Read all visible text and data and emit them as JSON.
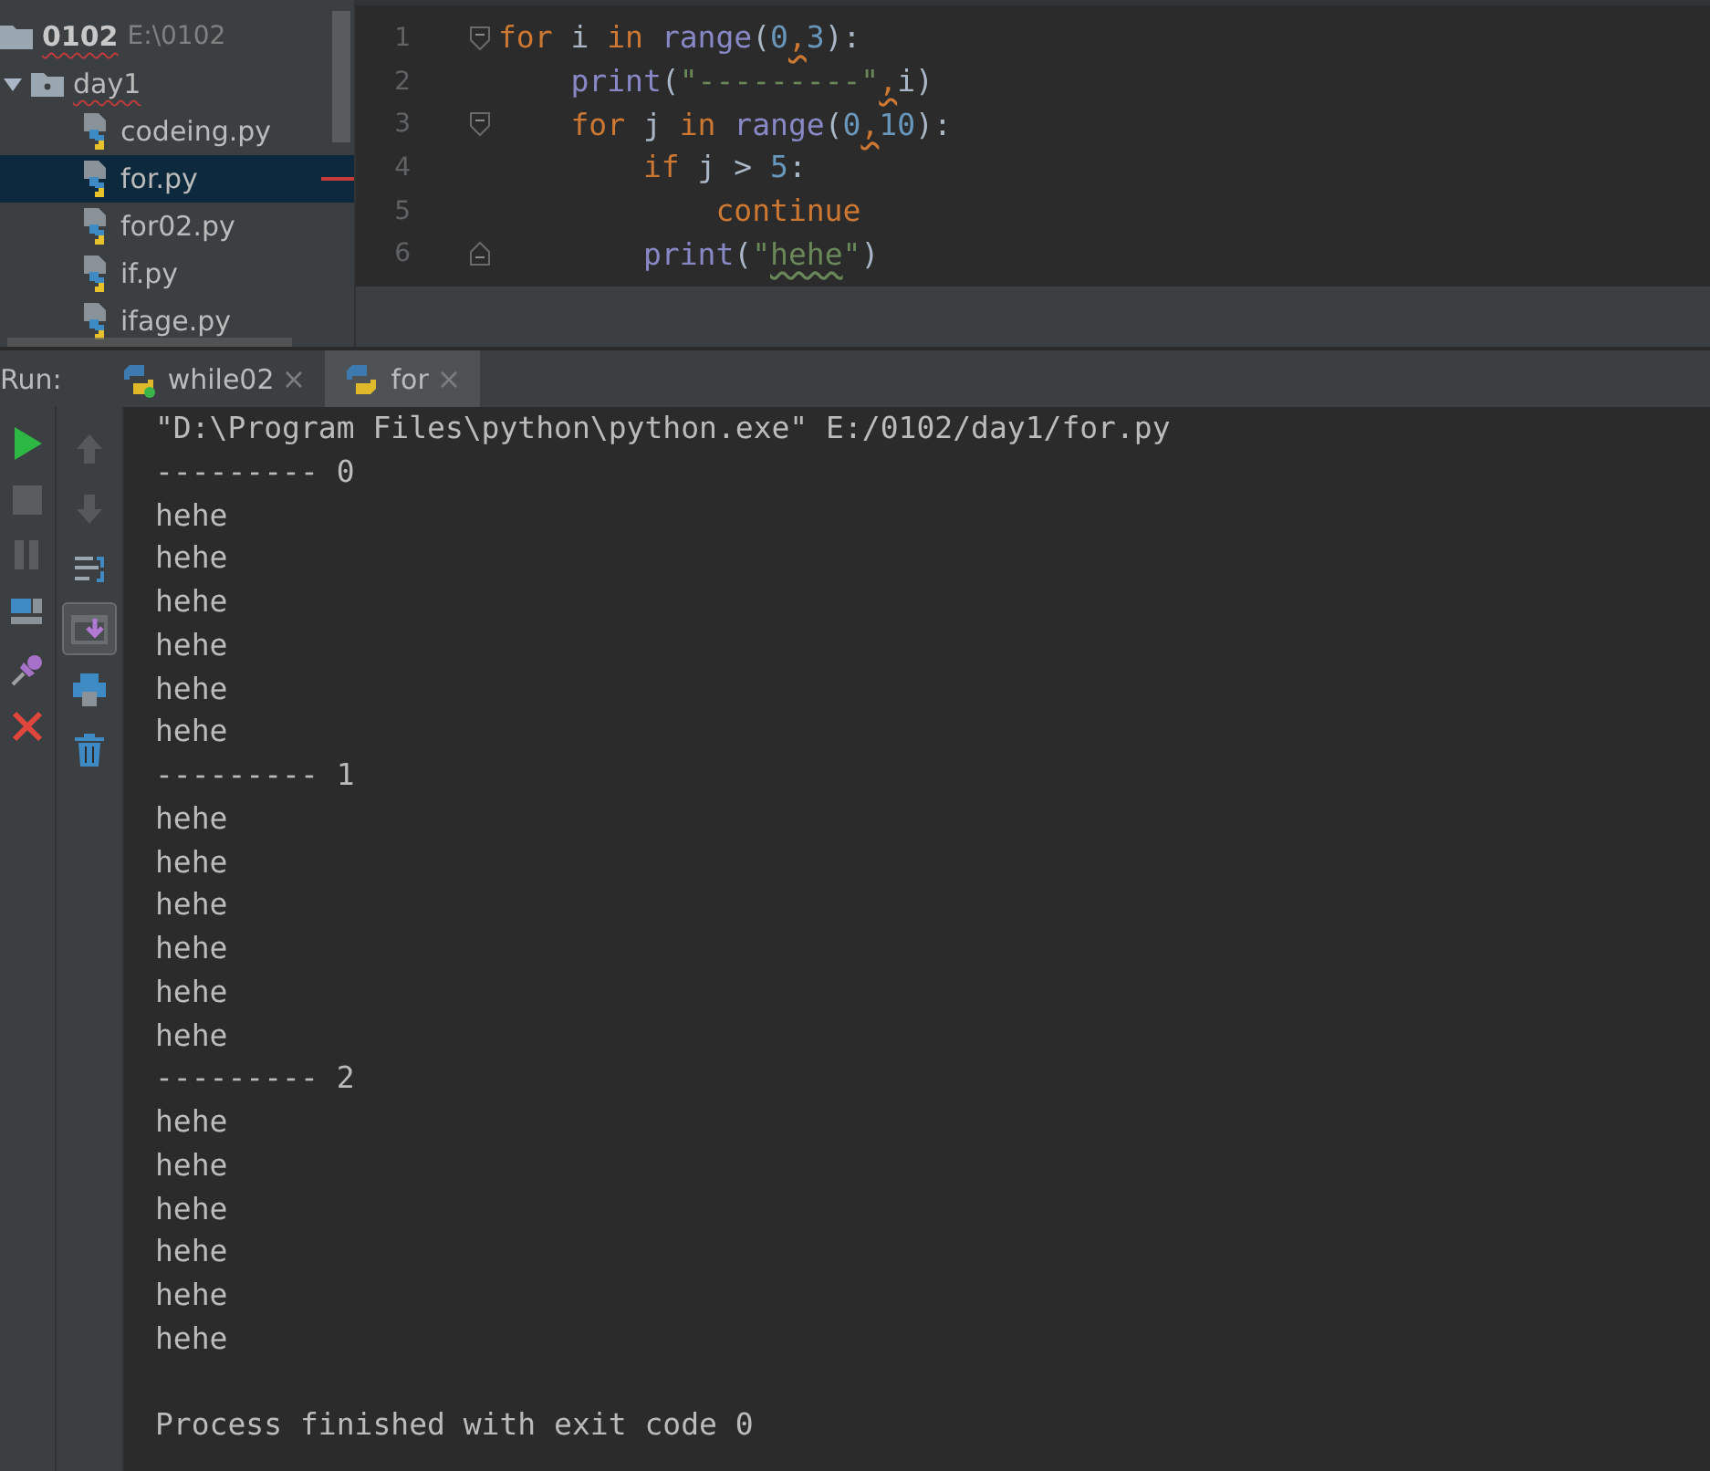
{
  "project_tree": {
    "root": {
      "name": "0102",
      "path": "E:\\0102",
      "expanded": true,
      "children": [
        {
          "name": "day1",
          "expanded": true,
          "children": [
            {
              "name": "codeing.py",
              "selected": false
            },
            {
              "name": "for.py",
              "selected": true
            },
            {
              "name": "for02.py",
              "selected": false
            },
            {
              "name": "if.py",
              "selected": false
            },
            {
              "name": "ifage.py",
              "selected": false
            }
          ]
        }
      ]
    }
  },
  "editor": {
    "lines": [
      {
        "number": "1",
        "fold_start": true,
        "fold_end": false,
        "tokens": [
          {
            "kind": "keyword",
            "text": "for"
          },
          {
            "kind": "plain",
            "text": " i "
          },
          {
            "kind": "keyword",
            "text": "in "
          },
          {
            "kind": "builtin",
            "text": "range"
          },
          {
            "kind": "plain",
            "text": "("
          },
          {
            "kind": "number",
            "text": "0"
          },
          {
            "kind": "warn",
            "text": ","
          },
          {
            "kind": "number",
            "text": "3"
          },
          {
            "kind": "plain",
            "text": "):"
          }
        ]
      },
      {
        "number": "2",
        "fold_start": false,
        "fold_end": false,
        "tokens": [
          {
            "kind": "builtin",
            "text": "    print"
          },
          {
            "kind": "plain",
            "text": "("
          },
          {
            "kind": "string",
            "text": "\"---------\""
          },
          {
            "kind": "warn",
            "text": ","
          },
          {
            "kind": "plain",
            "text": "i)"
          }
        ]
      },
      {
        "number": "3",
        "fold_start": true,
        "fold_end": false,
        "tokens": [
          {
            "kind": "keyword",
            "text": "    for"
          },
          {
            "kind": "plain",
            "text": " j "
          },
          {
            "kind": "keyword",
            "text": "in "
          },
          {
            "kind": "builtin",
            "text": "range"
          },
          {
            "kind": "plain",
            "text": "("
          },
          {
            "kind": "number",
            "text": "0"
          },
          {
            "kind": "warn",
            "text": ","
          },
          {
            "kind": "number",
            "text": "10"
          },
          {
            "kind": "plain",
            "text": "):"
          }
        ]
      },
      {
        "number": "4",
        "fold_start": false,
        "fold_end": false,
        "tokens": [
          {
            "kind": "keyword",
            "text": "        if"
          },
          {
            "kind": "plain",
            "text": " j > "
          },
          {
            "kind": "number",
            "text": "5"
          },
          {
            "kind": "plain",
            "text": ":"
          }
        ]
      },
      {
        "number": "5",
        "fold_start": false,
        "fold_end": false,
        "tokens": [
          {
            "kind": "keyword",
            "text": "            continue"
          }
        ]
      },
      {
        "number": "6",
        "fold_start": false,
        "fold_end": true,
        "tokens": [
          {
            "kind": "builtin",
            "text": "        print"
          },
          {
            "kind": "plain",
            "text": "("
          },
          {
            "kind": "string",
            "text": "\""
          },
          {
            "kind": "typo",
            "text": "hehe"
          },
          {
            "kind": "string",
            "text": "\""
          },
          {
            "kind": "plain",
            "text": ")"
          }
        ]
      }
    ]
  },
  "run": {
    "label": "Run:",
    "tabs": [
      {
        "label": "while02",
        "selected": false,
        "running": true
      },
      {
        "label": "for",
        "selected": true,
        "running": false
      }
    ],
    "left_toolbar": [
      {
        "kind": "run"
      },
      {
        "kind": "stop"
      },
      {
        "kind": "pause"
      },
      {
        "kind": "layout"
      },
      {
        "kind": "pin"
      },
      {
        "kind": "close"
      }
    ],
    "side_toolbar": [
      {
        "kind": "up",
        "pressed": false
      },
      {
        "kind": "down",
        "pressed": false
      },
      {
        "kind": "wrap",
        "pressed": false
      },
      {
        "kind": "scroll",
        "pressed": true
      },
      {
        "kind": "print",
        "pressed": false
      },
      {
        "kind": "trash",
        "pressed": false
      }
    ],
    "console": [
      {
        "kind": "command",
        "text": "\"D:\\Program Files\\python\\python.exe\" E:/0102/day1/for.py"
      },
      {
        "kind": "output",
        "text": "--------- 0"
      },
      {
        "kind": "output",
        "text": "hehe"
      },
      {
        "kind": "output",
        "text": "hehe"
      },
      {
        "kind": "output",
        "text": "hehe"
      },
      {
        "kind": "output",
        "text": "hehe"
      },
      {
        "kind": "output",
        "text": "hehe"
      },
      {
        "kind": "output",
        "text": "hehe"
      },
      {
        "kind": "output",
        "text": "--------- 1"
      },
      {
        "kind": "output",
        "text": "hehe"
      },
      {
        "kind": "output",
        "text": "hehe"
      },
      {
        "kind": "output",
        "text": "hehe"
      },
      {
        "kind": "output",
        "text": "hehe"
      },
      {
        "kind": "output",
        "text": "hehe"
      },
      {
        "kind": "output",
        "text": "hehe"
      },
      {
        "kind": "output",
        "text": "--------- 2"
      },
      {
        "kind": "output",
        "text": "hehe"
      },
      {
        "kind": "output",
        "text": "hehe"
      },
      {
        "kind": "output",
        "text": "hehe"
      },
      {
        "kind": "output",
        "text": "hehe"
      },
      {
        "kind": "output",
        "text": "hehe"
      },
      {
        "kind": "output",
        "text": "hehe"
      },
      {
        "kind": "status",
        "text": "Process finished with exit code 0"
      }
    ]
  }
}
